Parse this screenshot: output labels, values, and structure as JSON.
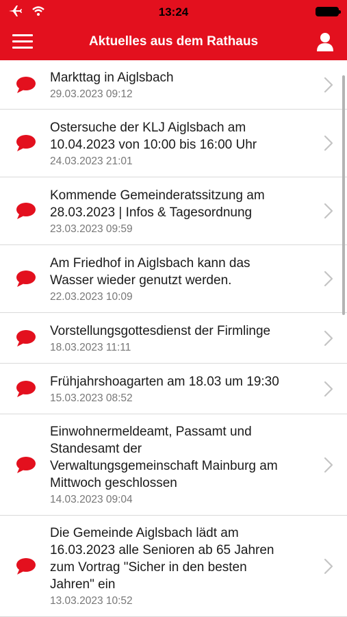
{
  "status": {
    "time": "13:24"
  },
  "nav": {
    "title": "Aktuelles aus dem Rathaus"
  },
  "colors": {
    "brand": "#e3101e"
  },
  "items": [
    {
      "lines": [
        "Markttag in Aiglsbach"
      ],
      "date": "29.03.2023 09:12"
    },
    {
      "lines": [
        "Ostersuche der KLJ Aiglsbach am",
        "10.04.2023 von 10:00 bis 16:00 Uhr"
      ],
      "date": "24.03.2023 21:01"
    },
    {
      "lines": [
        "Kommende Gemeinderatssitzung am",
        "28.03.2023 | Infos & Tagesordnung"
      ],
      "date": "23.03.2023 09:59"
    },
    {
      "lines": [
        "Am Friedhof in Aiglsbach kann das",
        "Wasser wieder genutzt werden."
      ],
      "date": "22.03.2023 10:09"
    },
    {
      "lines": [
        "Vorstellungsgottesdienst der Firmlinge"
      ],
      "date": "18.03.2023 11:11"
    },
    {
      "lines": [
        "Frühjahrshoagarten am 18.03 um 19:30"
      ],
      "date": "15.03.2023 08:52"
    },
    {
      "lines": [
        "Einwohnermeldeamt, Passamt und",
        "Standesamt der",
        "Verwaltungsgemeinschaft Mainburg am",
        "Mittwoch geschlossen"
      ],
      "date": "14.03.2023 09:04"
    },
    {
      "lines": [
        "Die Gemeinde Aiglsbach lädt am",
        "16.03.2023 alle Senioren ab 65 Jahren",
        "zum Vortrag \"Sicher in den besten",
        "Jahren\" ein"
      ],
      "date": "13.03.2023 10:52"
    }
  ]
}
